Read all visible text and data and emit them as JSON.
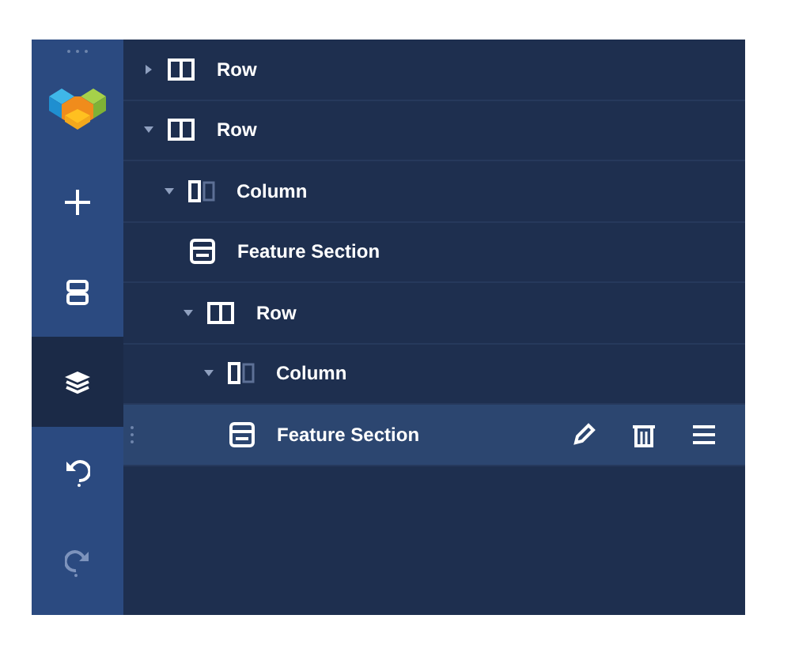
{
  "sidebar": {
    "items": [
      {
        "kind": "add",
        "selected": false,
        "disabled": false
      },
      {
        "kind": "sections",
        "selected": false,
        "disabled": false
      },
      {
        "kind": "layers",
        "selected": true,
        "disabled": false
      },
      {
        "kind": "undo",
        "selected": false,
        "disabled": false
      },
      {
        "kind": "redo",
        "selected": false,
        "disabled": true
      }
    ]
  },
  "tree": [
    {
      "kind": "row",
      "label": "Row",
      "expanded": false,
      "selected": false
    },
    {
      "kind": "row",
      "label": "Row",
      "expanded": true,
      "selected": false,
      "children": [
        {
          "kind": "column",
          "label": "Column",
          "expanded": true,
          "selected": false,
          "children": [
            {
              "kind": "section",
              "label": "Feature Section",
              "selected": false
            },
            {
              "kind": "row",
              "label": "Row",
              "expanded": true,
              "selected": false,
              "children": [
                {
                  "kind": "column",
                  "label": "Column",
                  "expanded": true,
                  "selected": false,
                  "children": [
                    {
                      "kind": "section",
                      "label": "Feature Section",
                      "selected": true
                    }
                  ]
                }
              ]
            }
          ]
        }
      ]
    }
  ]
}
